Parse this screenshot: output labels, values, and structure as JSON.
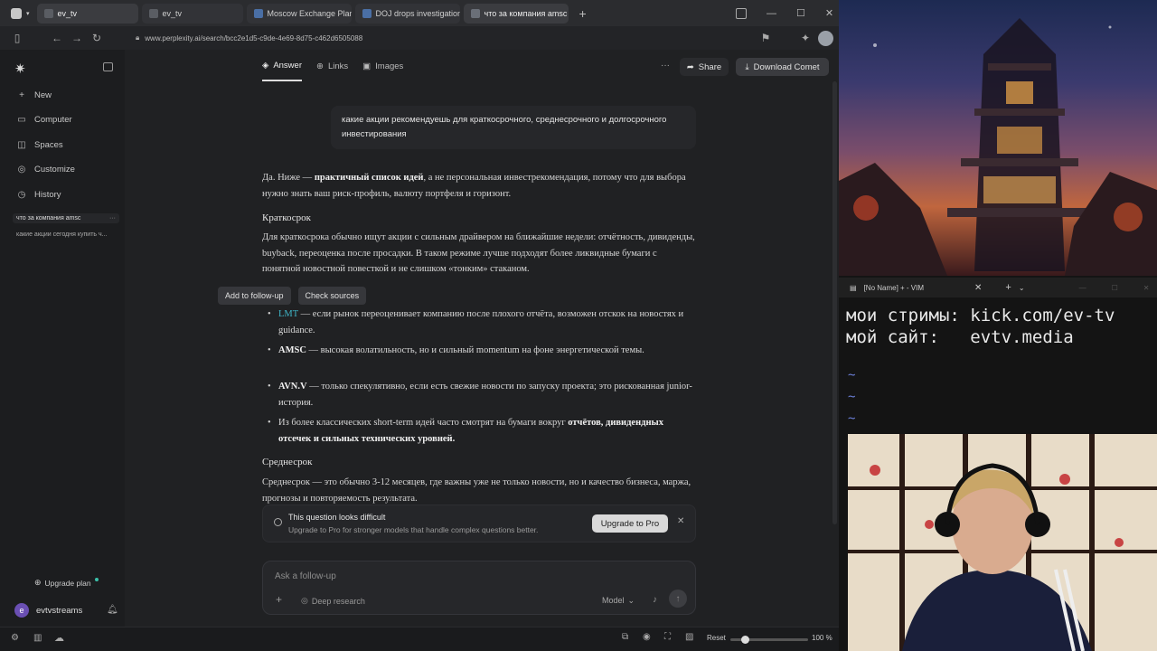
{
  "tabs": [
    {
      "label": "ev_tv"
    },
    {
      "label": "ev_tv"
    },
    {
      "label": "Moscow Exchange Plans Sc"
    },
    {
      "label": "DOJ drops investigation of"
    },
    {
      "label": "что за компания amsc"
    }
  ],
  "address": {
    "url": "www.perplexity.ai/search/bcc2e1d5-c9de-4e69-8d75-c462d6505088"
  },
  "sidebar": {
    "items": [
      {
        "label": "New",
        "icon": "plus-icon"
      },
      {
        "label": "Computer",
        "icon": "monitor-icon"
      },
      {
        "label": "Spaces",
        "icon": "spaces-icon"
      },
      {
        "label": "Customize",
        "icon": "customize-icon"
      },
      {
        "label": "History",
        "icon": "history-icon"
      }
    ],
    "history": [
      "что за компания amsc",
      "какие акции сегодня купить ч..."
    ],
    "upgrade": "Upgrade plan",
    "user": "evtvstreams",
    "avatar_letter": "e"
  },
  "toptabs": {
    "answer": "Answer",
    "links": "Links",
    "images": "Images",
    "share": "Share",
    "download": "Download Comet"
  },
  "query": "какие акции рекомендуешь для краткосрочного, среднесрочного и долгосрочного инвестирования",
  "answer": {
    "intro_a": "Да. Ниже — ",
    "intro_b": "практичный список идей",
    "intro_c": ", а не персональная инвестрекомендация, потому что для выбора нужно знать ваш риск-профиль, валюту портфеля и горизонт.",
    "short_heading": "Краткосрок",
    "short_text": "Для краткосрока обычно ищут акции с сильным драйвером на ближайшие недели: отчётность, дивиденды, buyback, переоценка после просадки. В таком режиме лучше подходят более ликвидные бумаги с понятной новостной повесткой и не слишком «тонким» стаканом.",
    "bullets": [
      {
        "ticker": "LMT",
        "text": " — если рынок переоценивает компанию после плохого отчёта, возможен отскок на новостях и guidance."
      },
      {
        "ticker": "AMSC",
        "text": " — высокая волатильность, но и сильный momentum на фоне энергетической темы."
      },
      {
        "ticker": "AVN.V",
        "text": " — только спекулятивно, если есть свежие новости по запуску проекта; это рискованная junior-история."
      },
      {
        "ticker": "",
        "text": "Из более классических short-term идей часто смотрят на бумаги вокруг ",
        "bold": "отчётов, дивидендных отсечек и сильных технических уровней."
      }
    ],
    "mid_heading": "Среднесрок",
    "mid_text": "Среднесрок — это обычно 3-12 месяцев, где важны уже не только новости, но и качество бизнеса, маржа, прогнозы и повторяемость результата."
  },
  "popup": {
    "follow": "Add to follow-up",
    "check": "Check sources"
  },
  "banner": {
    "title": "This question looks difficult",
    "text": "Upgrade to Pro for stronger models that handle complex questions better.",
    "button": "Upgrade to Pro"
  },
  "ask": {
    "placeholder": "Ask a follow-up",
    "deep": "Deep research",
    "model": "Model"
  },
  "status": {
    "reset": "Reset",
    "zoom": "100 %"
  },
  "vim": {
    "title": "[No Name] + - VIM",
    "line1": "мои стримы: kick.com/ev-tv",
    "line2": "мой сайт:   evtv.media"
  }
}
